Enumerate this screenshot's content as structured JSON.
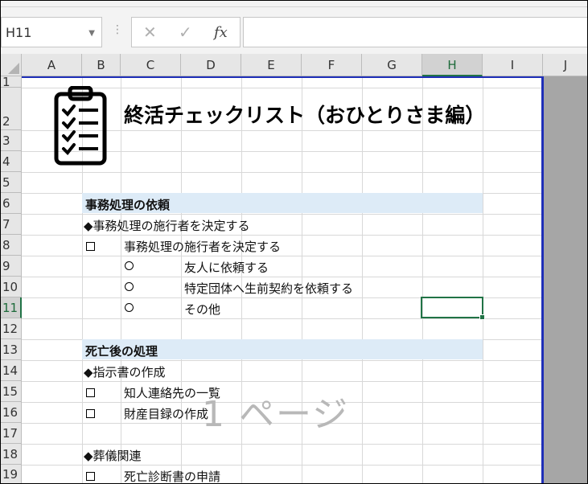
{
  "namebox": {
    "value": "H11",
    "dropdown_icon": "chevron-down-icon"
  },
  "formula_bar": {
    "cancel_icon": "✕",
    "enter_icon": "✓",
    "fx_label": "fx",
    "value": ""
  },
  "columns": [
    "A",
    "B",
    "C",
    "D",
    "E",
    "F",
    "G",
    "H",
    "I",
    "J"
  ],
  "selected_column": "H",
  "rows": [
    "1",
    "2",
    "3",
    "4",
    "5",
    "6",
    "7",
    "8",
    "9",
    "10",
    "11",
    "12",
    "13",
    "14",
    "15",
    "16",
    "17",
    "18",
    "19"
  ],
  "selected_row": "11",
  "selected_cell": "H11",
  "sheet": {
    "title": "終活チェックリスト（おひとりさま編）",
    "section1_header": "事務処理の依頼",
    "section1_sub": "◆事務処理の施行者を決定する",
    "section1_item": "事務処理の施行者を決定する",
    "option1": "友人に依頼する",
    "option2": "特定団体へ生前契約を依頼する",
    "option3": "その他",
    "section2_header": "死亡後の処理",
    "section2_sub": "◆指示書の作成",
    "section2_item1": "知人連絡先の一覧",
    "section2_item2": "財産目録の作成",
    "section3_sub": "◆葬儀関連",
    "section3_item1": "死亡診断書の申請"
  },
  "watermark": "1 ページ",
  "colors": {
    "accent": "#217346",
    "band": "#ddebf7",
    "page_break": "#1f2fb8"
  }
}
